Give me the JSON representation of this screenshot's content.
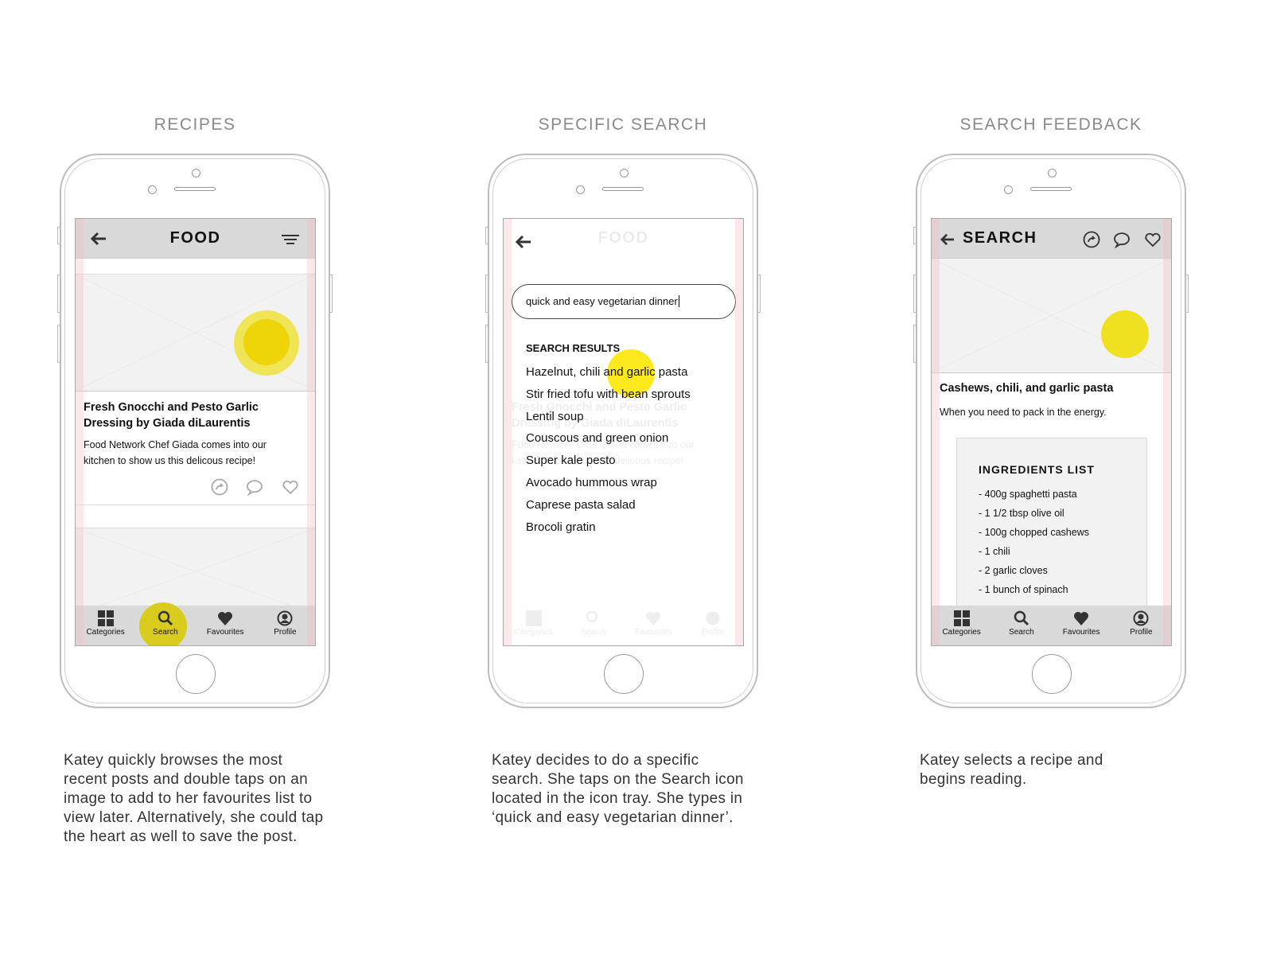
{
  "columns": [
    {
      "title": "RECIPES",
      "caption": "Katey quickly browses the most recent posts and double taps on an image to add to her favourites list to view later. Alternatively, she could tap the heart as well to save the post."
    },
    {
      "title": "SPECIFIC SEARCH",
      "caption": "Katey decides to do a specific search. She taps on the Search icon located in the icon tray. She types in ‘quick and easy vegetarian dinner’."
    },
    {
      "title": "SEARCH FEEDBACK",
      "caption": "Katey selects a recipe and begins reading."
    }
  ],
  "tabs": [
    "Categories",
    "Search",
    "Favourites",
    "Profile"
  ],
  "screen1": {
    "header_title": "FOOD",
    "post_title": "Fresh Gnocchi and Pesto Garlic Dressing by Giada diLaurentis",
    "post_desc": "Food Network Chef Giada comes into our kitchen to show us this delicous recipe!"
  },
  "screen2": {
    "header_title": "FOOD",
    "search_value": "quick and easy vegetarian dinner",
    "results_heading": "SEARCH RESULTS",
    "results": [
      "Hazelnut, chili and garlic pasta",
      "Stir fried tofu with bean sprouts",
      "Lentil soup",
      "Couscous and green onion",
      "Super kale pesto",
      "Avocado hummous wrap",
      "Caprese pasta salad",
      "Brocoli gratin"
    ]
  },
  "screen3": {
    "header_title": "SEARCH",
    "recipe_title": "Cashews, chili, and garlic pasta",
    "recipe_desc": "When you need to pack in the energy.",
    "ingredients_heading": "INGREDIENTS LIST",
    "ingredients": [
      "- 400g spaghetti pasta",
      "- 1 1/2 tbsp olive oil",
      "- 100g chopped cashews",
      "- 1 chili",
      "- 2 garlic cloves",
      "- 1 bunch of spinach"
    ]
  },
  "colors": {
    "highlight": "#f0e014",
    "header": "#d9d9d9",
    "edge_guide": "#f5bec4"
  }
}
